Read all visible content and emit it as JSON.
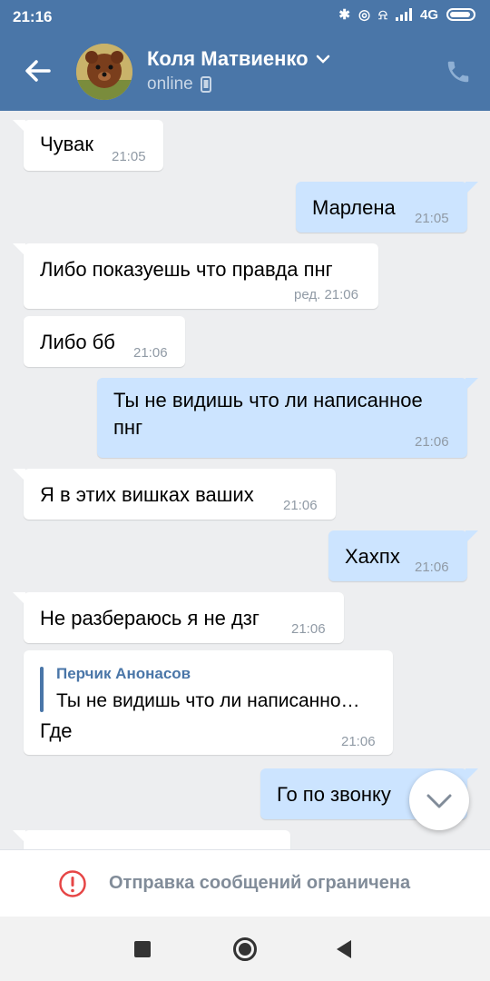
{
  "status_bar": {
    "time": "21:16",
    "network": "4G"
  },
  "header": {
    "contact_name": "Коля Матвиенко",
    "status": "online"
  },
  "messages": [
    {
      "direction": "in",
      "text": "Чувак",
      "time": "21:05"
    },
    {
      "direction": "out",
      "text": "Марлена",
      "time": "21:05"
    },
    {
      "direction": "in",
      "text": "Либо показуешь что правда пнг",
      "time": "ред. 21:06"
    },
    {
      "direction": "in",
      "text": "Либо бб",
      "time": "21:06"
    },
    {
      "direction": "out",
      "text_line1": "Ты не видишь что ли написанное",
      "text_line2": "пнг",
      "time": "21:06"
    },
    {
      "direction": "in",
      "text": "Я в этих вишках ваших",
      "time": "21:06"
    },
    {
      "direction": "out",
      "text": "Хахпх",
      "time": "21:06"
    },
    {
      "direction": "in",
      "text": "Не разбераюсь я не дзг",
      "time": "21:06"
    },
    {
      "direction": "in",
      "reply_author": "Перчик Анонасов",
      "reply_text": "Ты не видишь что ли написанно…",
      "text": "Где",
      "time": "21:06"
    },
    {
      "direction": "out",
      "text": "Го по звонку",
      "time": ""
    }
  ],
  "restriction": {
    "text": "Отправка сообщений ограничена"
  },
  "colors": {
    "header": "#4a76a8",
    "bubble_out": "#cce4ff",
    "bubble_in": "#ffffff",
    "background": "#edeef0",
    "error": "#e64646"
  }
}
